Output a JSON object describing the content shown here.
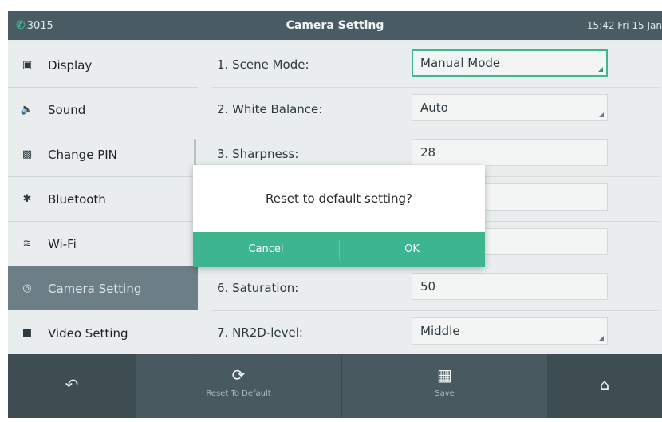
{
  "status_bar": {
    "extension": "3015",
    "phone_icon": "phone-icon",
    "title": "Camera Setting",
    "datetime": "15:42 Fri 15 Jan"
  },
  "sidebar": {
    "items": [
      {
        "label": "Display",
        "icon": "display-icon"
      },
      {
        "label": "Sound",
        "icon": "speaker-icon"
      },
      {
        "label": "Change PIN",
        "icon": "lock-icon"
      },
      {
        "label": "Bluetooth",
        "icon": "bluetooth-icon"
      },
      {
        "label": "Wi-Fi",
        "icon": "wifi-icon"
      },
      {
        "label": "Camera Setting",
        "icon": "camera-icon"
      },
      {
        "label": "Video Setting",
        "icon": "video-icon"
      }
    ],
    "active_item": "Camera Setting"
  },
  "settings": {
    "rows": [
      {
        "label": "1. Scene Mode:",
        "value": "Manual Mode"
      },
      {
        "label": "2. White Balance:",
        "value": "Auto"
      },
      {
        "label": "3. Sharpness:",
        "value": "28"
      },
      {
        "label": "",
        "value": ""
      },
      {
        "label": "",
        "value": ""
      },
      {
        "label": "6. Saturation:",
        "value": "50"
      },
      {
        "label": "7. NR2D-level:",
        "value": "Middle"
      }
    ]
  },
  "dialog": {
    "message": "Reset to default setting?",
    "cancel_label": "Cancel",
    "ok_label": "OK"
  },
  "softkeys": {
    "back_icon": "back-arrow-icon",
    "reset_label": "Reset To Default",
    "reset_icon": "refresh-icon",
    "save_label": "Save",
    "save_icon": "save-icon",
    "home_icon": "home-icon"
  },
  "colors": {
    "accent_green": "#3db58e",
    "title_bar": "#4a5c63",
    "bottom_bar": "#3d4d52",
    "active_sidebar": "#6d7f86"
  }
}
